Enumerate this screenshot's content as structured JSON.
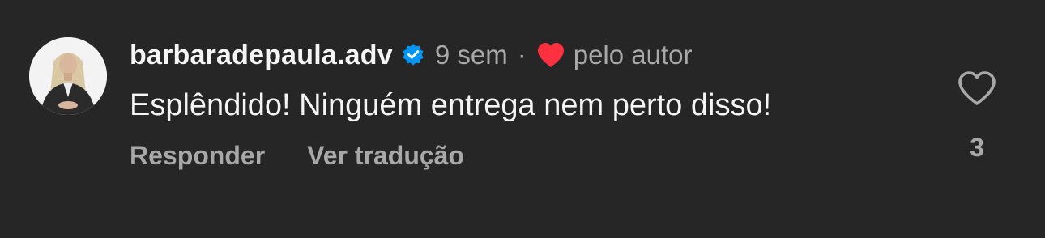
{
  "comment": {
    "avatar_icon": "profile-photo",
    "username": "barbaradepaula.adv",
    "verified_icon": "verified-badge-icon",
    "timestamp": "9 sem",
    "separator": "·",
    "author_like_icon": "heart-filled-icon",
    "author_like_label": "pelo autor",
    "text": "Esplêndido! Ninguém entrega nem perto disso!",
    "actions": {
      "reply": "Responder",
      "translate": "Ver tradução"
    },
    "likes": {
      "icon": "heart-outline-icon",
      "count": "3"
    }
  },
  "colors": {
    "background": "#262626",
    "primary_text": "#f5f5f5",
    "secondary_text": "#a8a8a8",
    "verified_blue": "#0095f6",
    "heart_red": "#ff3040"
  }
}
